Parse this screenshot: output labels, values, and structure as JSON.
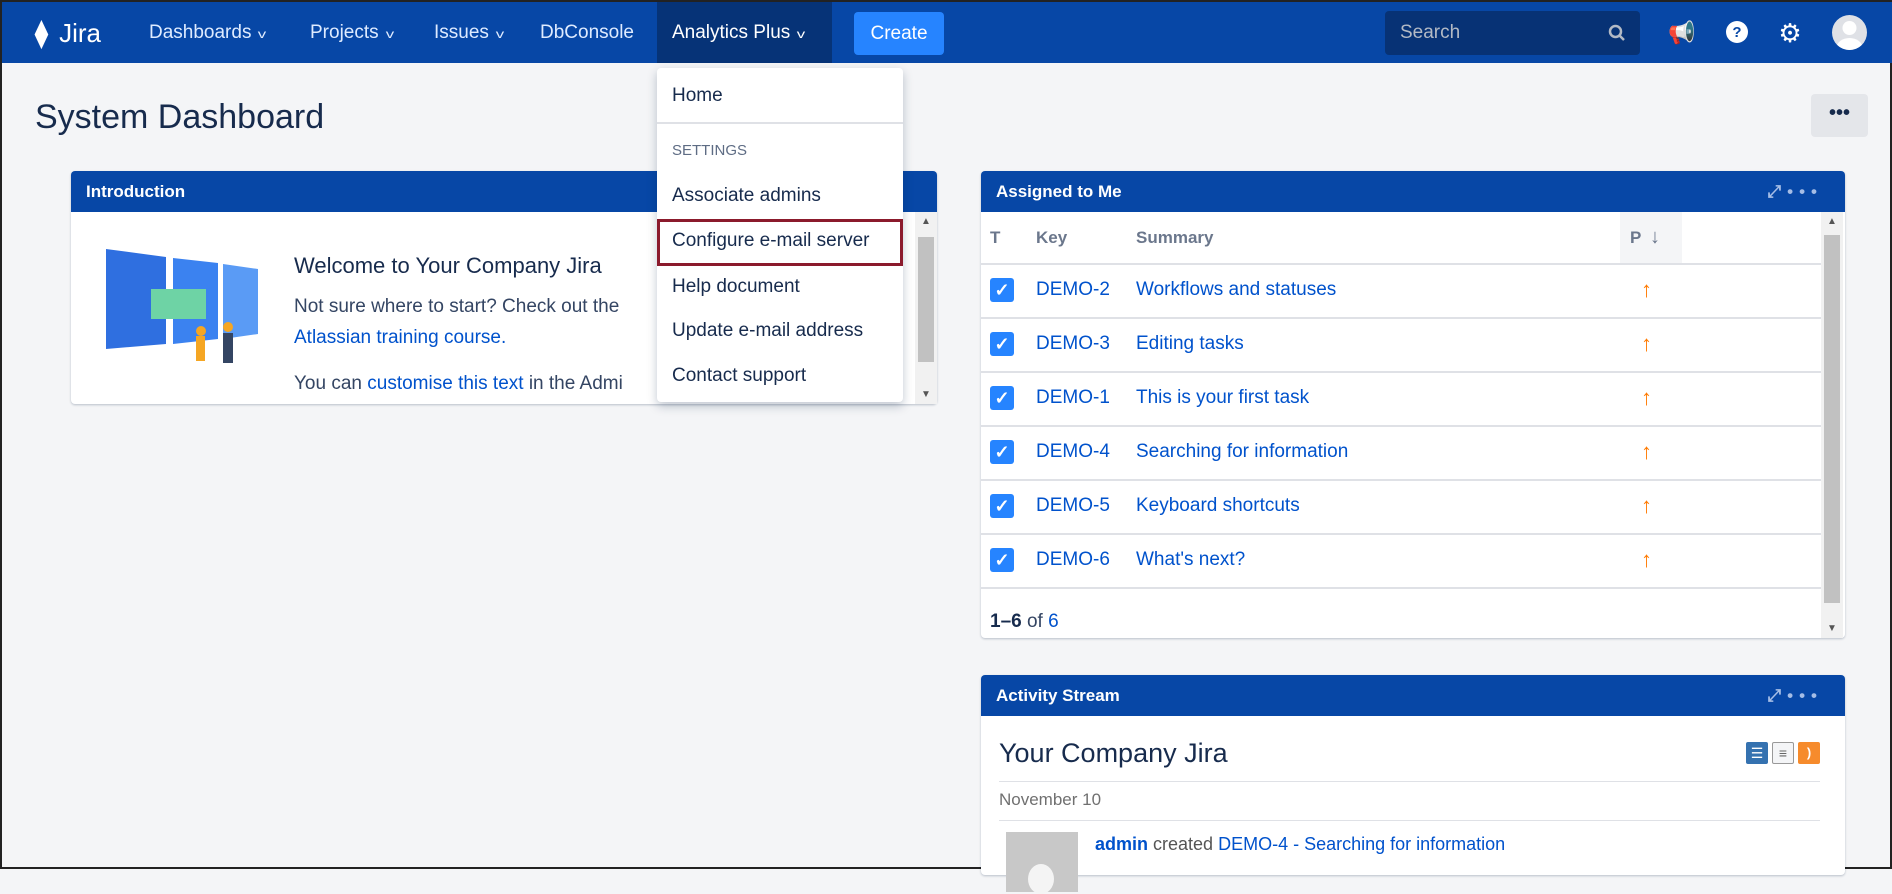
{
  "nav": {
    "logo": "Jira",
    "items": [
      {
        "label": "Dashboards"
      },
      {
        "label": "Projects"
      },
      {
        "label": "Issues"
      },
      {
        "label": "DbConsole"
      },
      {
        "label": "Analytics Plus"
      }
    ],
    "create": "Create",
    "search_placeholder": "Search"
  },
  "page": {
    "title": "System Dashboard",
    "more": "•••"
  },
  "dropdown": {
    "home": "Home",
    "section": "SETTINGS",
    "items": [
      "Associate admins",
      "Configure e-mail server",
      "Help document",
      "Update e-mail address",
      "Contact support"
    ]
  },
  "intro": {
    "title": "Introduction",
    "heading": "Welcome to Your Company Jira",
    "line1": "Not sure where to start? Check out the",
    "link1": "Atlassian training course.",
    "line2_pre": "You can ",
    "link2": "customise this text",
    "line2_post": " in the Admi"
  },
  "assigned": {
    "title": "Assigned to Me",
    "columns": [
      "T",
      "Key",
      "Summary",
      "P"
    ],
    "rows": [
      {
        "key": "DEMO-2",
        "summary": "Workflows and statuses"
      },
      {
        "key": "DEMO-3",
        "summary": "Editing tasks"
      },
      {
        "key": "DEMO-1",
        "summary": "This is your first task"
      },
      {
        "key": "DEMO-4",
        "summary": "Searching for information"
      },
      {
        "key": "DEMO-5",
        "summary": "Keyboard shortcuts"
      },
      {
        "key": "DEMO-6",
        "summary": "What's next?"
      }
    ],
    "footer_range": "1–6",
    "footer_of": "of",
    "footer_total": "6"
  },
  "activity": {
    "title": "Activity Stream",
    "heading": "Your Company Jira",
    "date": "November 10",
    "entry": {
      "user": "admin",
      "verb": "created",
      "issue": "DEMO-4 - Searching for information"
    }
  },
  "colors": {
    "nav": "#0747a6",
    "accent": "#2684ff",
    "highlight": "#8b1a2c",
    "priority": "#ff7a00"
  }
}
